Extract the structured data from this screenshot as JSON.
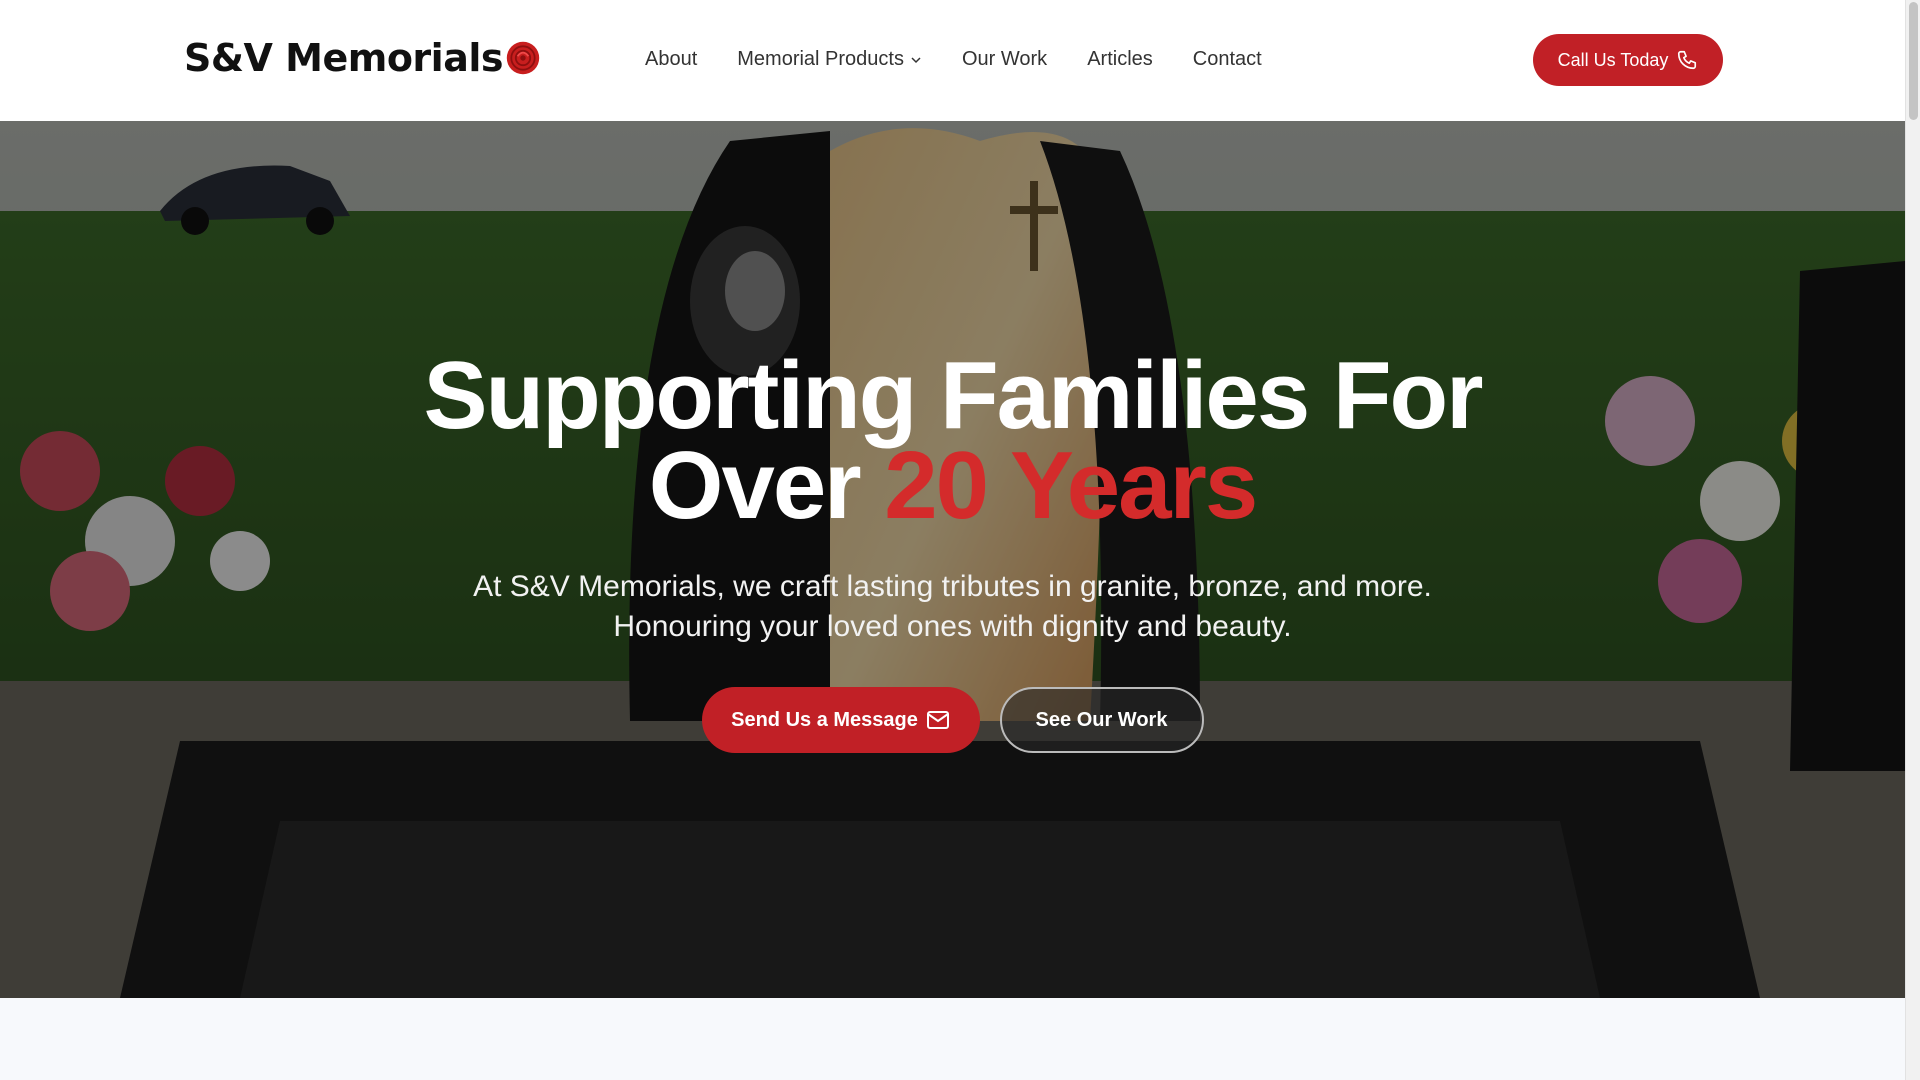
{
  "header": {
    "logo_text": "S&V Memorials",
    "logo_icon": "rose-icon",
    "nav": [
      {
        "label": "About"
      },
      {
        "label": "Memorial Products",
        "has_dropdown": true
      },
      {
        "label": "Our Work"
      },
      {
        "label": "Articles"
      },
      {
        "label": "Contact"
      }
    ],
    "cta_label": "Call Us Today",
    "cta_icon": "phone-icon"
  },
  "hero": {
    "title_line1": "Supporting Families For",
    "title_line2_prefix": "Over",
    "title_line2_accent": "20 Years",
    "subtitle_line1": "At S&V Memorials, we craft lasting tributes in granite, bronze, and more.",
    "subtitle_line2": "Honouring your loved ones with dignity and beauty.",
    "primary_button": "Send Us a Message",
    "primary_button_icon": "mail-icon",
    "secondary_button": "See Our Work"
  },
  "colors": {
    "brand_red": "#c12026",
    "accent_red": "#d42b2b",
    "page_bg": "#f7f9fc"
  }
}
